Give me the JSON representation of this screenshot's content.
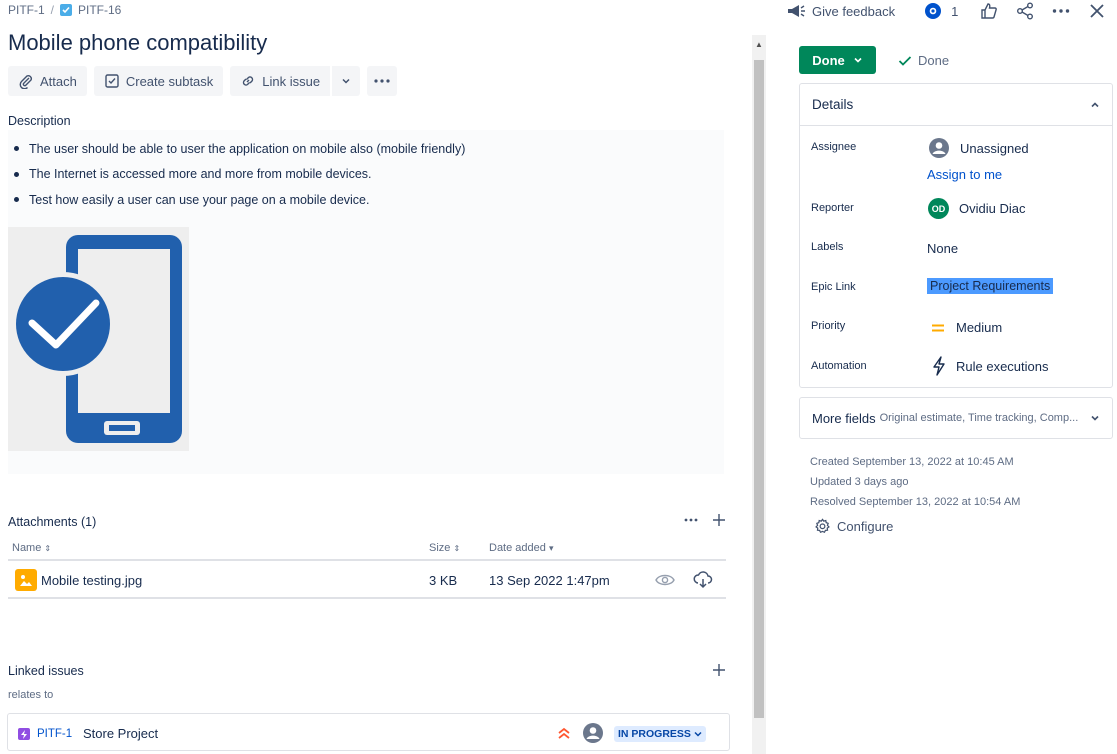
{
  "breadcrumb": {
    "parent": "PITF-1",
    "separator": "/",
    "current": "PITF-16"
  },
  "issue": {
    "title": "Mobile phone compatibility"
  },
  "toolbar": {
    "attach": "Attach",
    "create_subtask": "Create subtask",
    "link_issue": "Link issue"
  },
  "description": {
    "label": "Description",
    "items": [
      "The user should be able to user the application on mobile also (mobile friendly)",
      "The Internet is accessed more and more from mobile devices.",
      "Test how easily a user can use your page on a mobile device."
    ]
  },
  "attachments": {
    "title": "Attachments (1)",
    "columns": {
      "name": "Name",
      "size": "Size",
      "date": "Date added"
    },
    "files": [
      {
        "name": "Mobile testing.jpg",
        "size": "3 KB",
        "date": "13 Sep 2022 1:47pm"
      }
    ]
  },
  "linked": {
    "title": "Linked issues",
    "relation": "relates to",
    "issues": [
      {
        "key": "PITF-1",
        "summary": "Store Project",
        "status": "IN PROGRESS"
      }
    ]
  },
  "topbar": {
    "feedback": "Give feedback",
    "watchers": "1"
  },
  "status": {
    "button": "Done",
    "resolution": "Done"
  },
  "details": {
    "title": "Details",
    "assignee_label": "Assignee",
    "assignee_value": "Unassigned",
    "assign_to_me": "Assign to me",
    "reporter_label": "Reporter",
    "reporter_initials": "OD",
    "reporter_value": "Ovidiu Diac",
    "labels_label": "Labels",
    "labels_value": "None",
    "epic_label": "Epic Link",
    "epic_value": "Project Requirements",
    "priority_label": "Priority",
    "priority_value": "Medium",
    "automation_label": "Automation",
    "automation_value": "Rule executions"
  },
  "more_fields": {
    "label": "More fields",
    "hint": "Original estimate, Time tracking, Comp..."
  },
  "meta": {
    "created": "Created September 13, 2022 at 10:45 AM",
    "updated": "Updated 3 days ago",
    "resolved": "Resolved September 13, 2022 at 10:54 AM",
    "configure": "Configure"
  },
  "colors": {
    "done_green": "#00875a",
    "link_blue": "#0052cc",
    "epic_highlight": "#4c9aff",
    "brand_blue": "#2160ad"
  }
}
